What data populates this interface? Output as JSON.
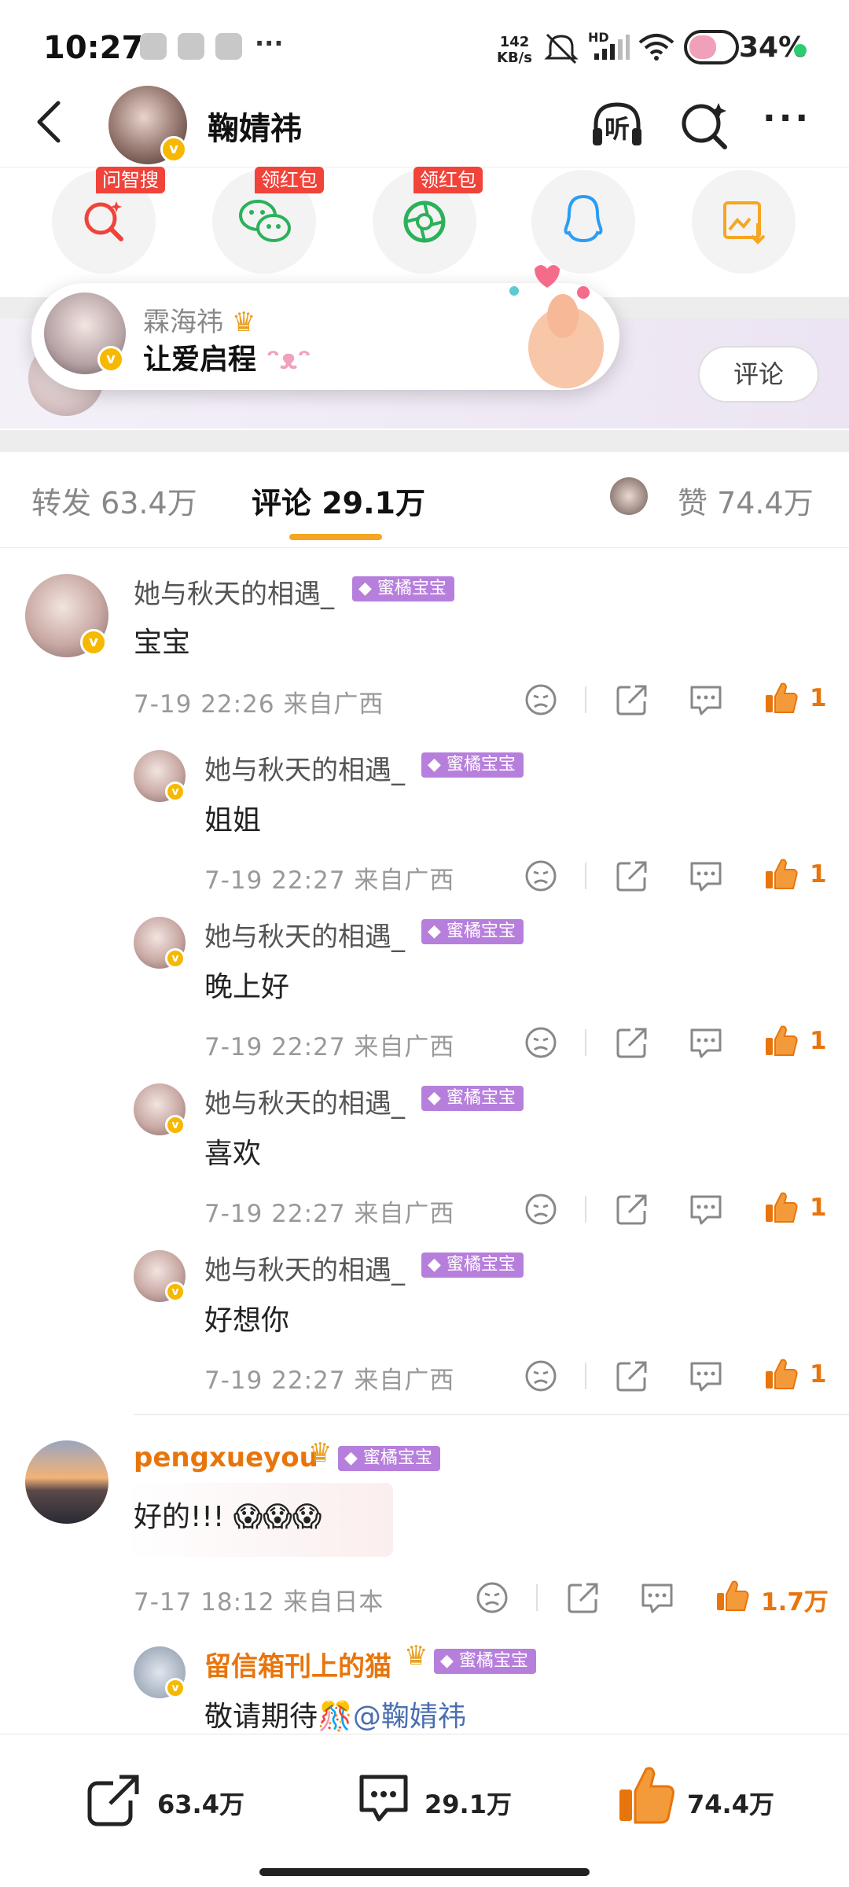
{
  "status": {
    "time": "10:27",
    "net_speed_value": "142",
    "net_speed_unit": "KB/s",
    "hd": "HD",
    "battery": "34%"
  },
  "header": {
    "name": "鞠婧祎",
    "listen_label": "听"
  },
  "quick": [
    {
      "tag": "问智搜",
      "icon": "smart-search-icon",
      "color": "#f0433a"
    },
    {
      "tag": "领红包",
      "icon": "wechat-icon",
      "color": "#2bb15a"
    },
    {
      "tag": "领红包",
      "icon": "moments-icon",
      "color": "#2bb15a"
    },
    {
      "tag": "",
      "icon": "qq-icon",
      "color": "#2a9df4"
    },
    {
      "tag": "",
      "icon": "save-image-icon",
      "color": "#f5a623"
    }
  ],
  "banner": {
    "name": "霖海祎",
    "message": "让爱启程",
    "comment_button": "评论"
  },
  "tabs": {
    "repost": "转发 63.4万",
    "comments": "评论 29.1万",
    "likes": "赞 74.4万"
  },
  "comments": [
    {
      "name": "她与秋天的相遇_",
      "badge": "蜜橘宝宝",
      "text": "宝宝",
      "meta": "7-19 22:26  来自广西",
      "likes": "1",
      "replies": [
        {
          "name": "她与秋天的相遇_",
          "badge": "蜜橘宝宝",
          "text": "姐姐",
          "meta": "7-19 22:27  来自广西",
          "likes": "1"
        },
        {
          "name": "她与秋天的相遇_",
          "badge": "蜜橘宝宝",
          "text": "晚上好",
          "meta": "7-19 22:27  来自广西",
          "likes": "1"
        },
        {
          "name": "她与秋天的相遇_",
          "badge": "蜜橘宝宝",
          "text": "喜欢",
          "meta": "7-19 22:27  来自广西",
          "likes": "1"
        },
        {
          "name": "她与秋天的相遇_",
          "badge": "蜜橘宝宝",
          "text": "好想你",
          "meta": "7-19 22:27  来自广西",
          "likes": "1"
        }
      ]
    },
    {
      "name": "pengxueyou",
      "badge": "蜜橘宝宝",
      "text": "好的!!! 😱😱😱",
      "meta": "7-17 18:12  来自日本",
      "likes": "1.7万",
      "replies": [
        {
          "name": "留信箱刊上的猫",
          "badge": "蜜橘宝宝",
          "text_prefix": "敬请期待",
          "mention": "@鞠婧祎"
        }
      ]
    }
  ],
  "bottom": {
    "repost": "63.4万",
    "comments": "29.1万",
    "likes": "74.4万"
  },
  "colors": {
    "accent": "#e8750c",
    "tab_indicator": "#f5a623",
    "badge": "#b77fdc",
    "vip": "#f6b800"
  }
}
